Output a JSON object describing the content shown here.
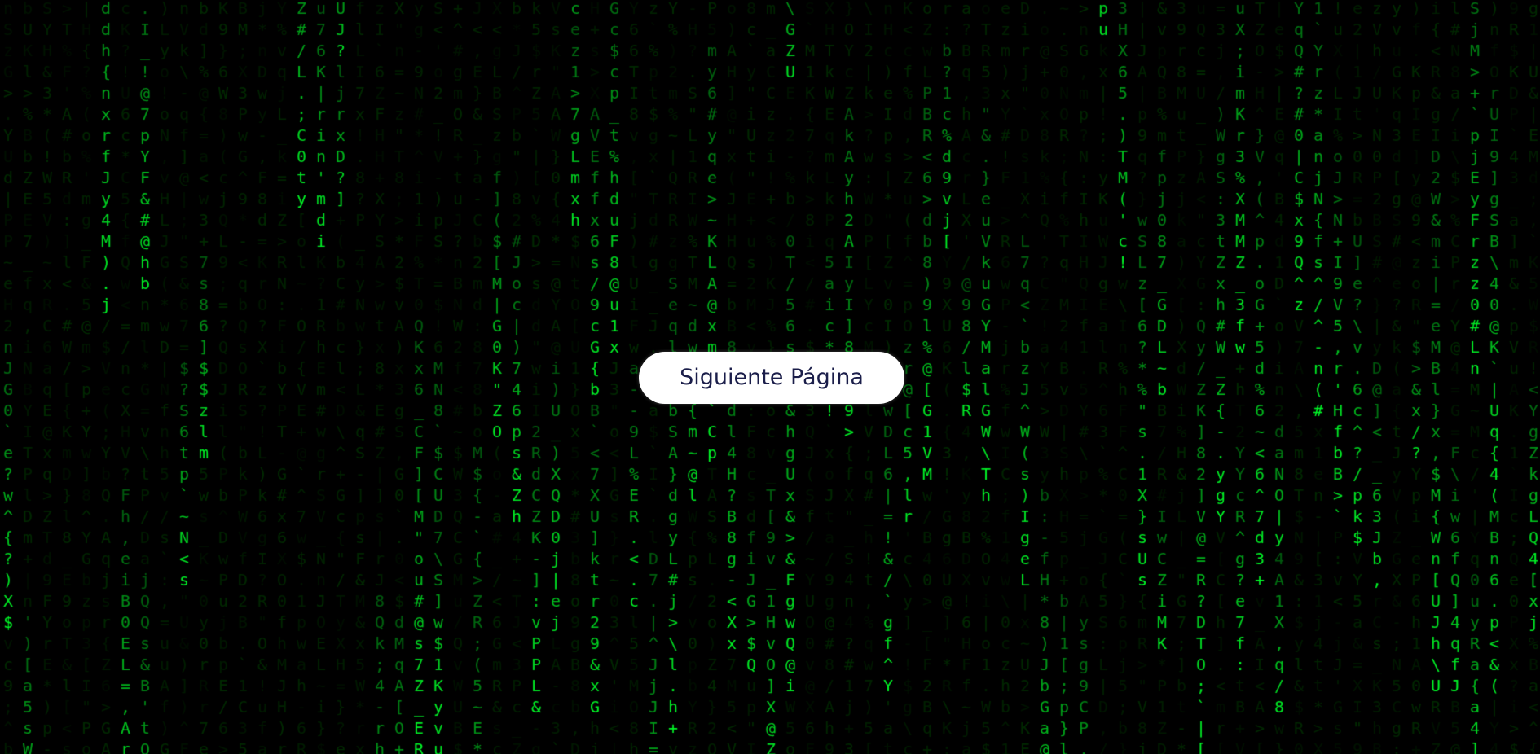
{
  "page": {
    "background_color": "#000000",
    "rain_color": "#00ff00",
    "rain_glyph_sample": "0123456789abcdefghijklmnopqrstuvwxyzABCDEFGHIJKLMNOPQRSTUVWXYZ@#$%^&*()[]{};:'\",.<>/?\\|`~+-=_!"
  },
  "cta": {
    "label": "Siguiente Página",
    "background_color": "#ffffff",
    "text_color": "#1b1e4a"
  }
}
